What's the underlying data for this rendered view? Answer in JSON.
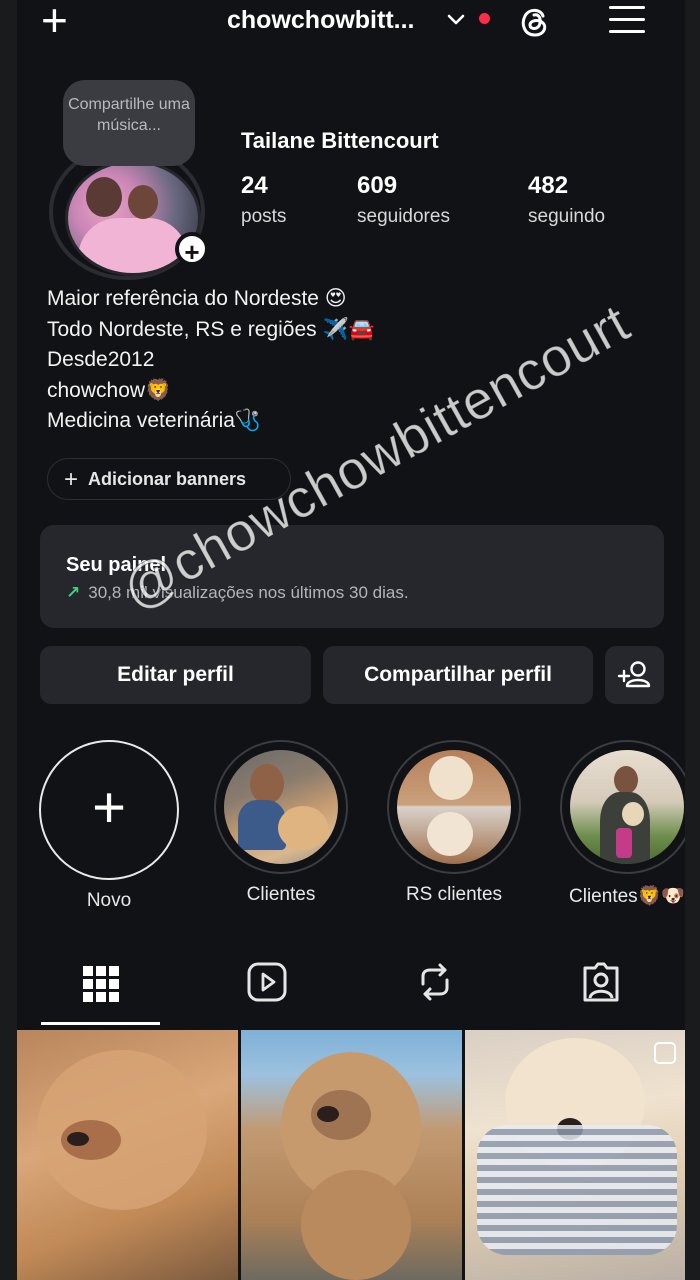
{
  "topbar": {
    "username": "chowchowbitt...",
    "chevron_icon": "chevron-down-icon",
    "threads_icon": "threads-icon",
    "menu_icon": "hamburger-menu-icon",
    "new_post_icon": "plus-icon"
  },
  "profile": {
    "note": "Compartilhe uma música...",
    "name": "Tailane Bittencourt",
    "stats": [
      {
        "value": "24",
        "label": "posts"
      },
      {
        "value": "609",
        "label": "seguidores"
      },
      {
        "value": "482",
        "label": "seguindo"
      }
    ],
    "bio": [
      "Maior referência do Nordeste 😍",
      "Todo Nordeste, RS e regiões ✈️🚘",
      "Desde2012",
      "chowchow🦁",
      "Medicina veterinária🩺"
    ],
    "add_banners": "Adicionar banners"
  },
  "panel": {
    "title": "Seu painel",
    "subtitle": "30,8 mil visualizações nos últimos 30 dias."
  },
  "buttons": {
    "edit": "Editar perfil",
    "share": "Compartilhar perfil",
    "discover_icon": "add-person-icon"
  },
  "highlights": [
    {
      "label": "Novo"
    },
    {
      "label": "Clientes"
    },
    {
      "label": "RS clientes"
    },
    {
      "label": "Clientes🦁🐶"
    }
  ],
  "tabs": [
    "grid-icon",
    "reels-icon",
    "reposts-icon",
    "tagged-icon"
  ],
  "watermark": "@chowchowbittencourt",
  "colors": {
    "background": "#101216",
    "card": "#25272c",
    "live_dot": "#ff2b48",
    "trend_up": "#3fd07a"
  }
}
